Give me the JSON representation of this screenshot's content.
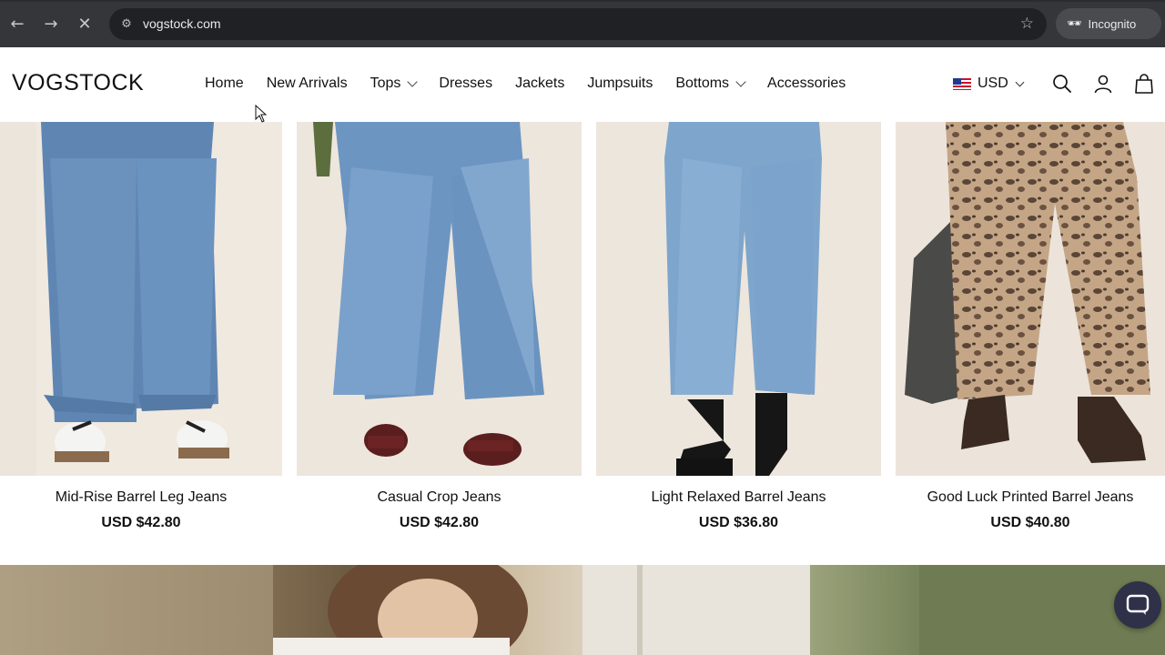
{
  "browser": {
    "url": "vogstock.com",
    "incognito_label": "Incognito",
    "back_icon": "arrow-left-icon",
    "forward_icon": "arrow-right-icon",
    "stop_icon": "close-icon"
  },
  "store": {
    "logo": "VOGSTOCK",
    "nav": [
      {
        "label": "Home"
      },
      {
        "label": "New Arrivals"
      },
      {
        "label": "Tops",
        "dropdown": true
      },
      {
        "label": "Dresses"
      },
      {
        "label": "Jackets"
      },
      {
        "label": "Jumpsuits"
      },
      {
        "label": "Bottoms",
        "dropdown": true
      },
      {
        "label": "Accessories"
      }
    ],
    "currency": "USD",
    "icons": [
      "search-icon",
      "account-icon",
      "cart-icon"
    ]
  },
  "products": [
    {
      "name": "Mid-Rise Barrel Leg Jeans",
      "price": "USD $42.80"
    },
    {
      "name": "Casual Crop Jeans",
      "price": "USD $42.80"
    },
    {
      "name": "Light Relaxed Barrel Jeans",
      "price": "USD $36.80"
    },
    {
      "name": "Good Luck Printed Barrel Jeans",
      "price": "USD $40.80"
    }
  ],
  "colors": {
    "chrome_bg": "#35363a",
    "omnibox_bg": "#202124",
    "denim": "#6f93b8",
    "leopard": "#b79a7c",
    "chat_button": "#2f3148"
  }
}
